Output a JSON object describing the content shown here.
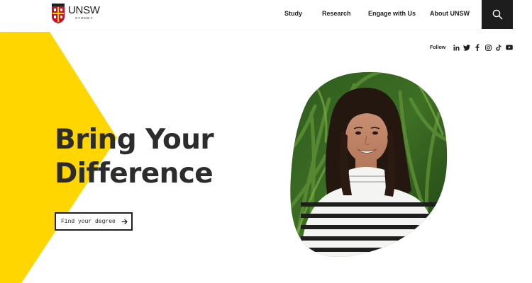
{
  "header": {
    "logo": {
      "wordmark": "UNSW",
      "subtitle": "SYDNEY"
    },
    "nav": [
      {
        "label": "Study"
      },
      {
        "label": "Research"
      },
      {
        "label": "Engage with Us"
      },
      {
        "label": "About UNSW"
      }
    ],
    "search_icon": "search-icon"
  },
  "follow": {
    "label": "Follow",
    "icons": [
      "linkedin-icon",
      "twitter-icon",
      "facebook-icon",
      "instagram-icon",
      "tiktok-icon",
      "youtube-icon"
    ]
  },
  "hero": {
    "title_line1": "Bring Your",
    "title_line2": "Difference",
    "cta_label": "Find your degree",
    "cta_icon": "arrow-right-icon"
  },
  "colors": {
    "accent_yellow": "#ffd600",
    "dark": "#1d1d1d",
    "text": "#2c2c2c"
  }
}
